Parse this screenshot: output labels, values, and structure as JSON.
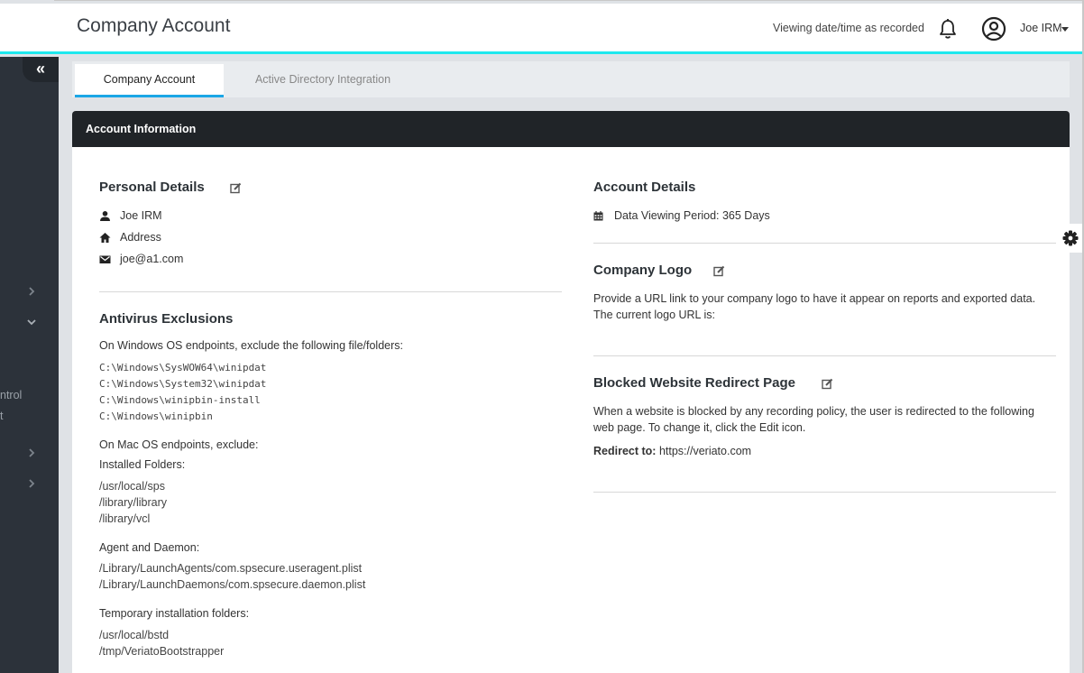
{
  "header": {
    "title": "Company Account",
    "viewing_text": "Viewing date/time as recorded",
    "user_name": "Joe IRM",
    "icons": {
      "notifications": "bell-icon",
      "user": "user-circle-icon",
      "dropdown": "caret-down-icon"
    }
  },
  "sidebar": {
    "collapse_icon": "«",
    "partial_labels": [
      "ntrol",
      "t"
    ],
    "chevrons": [
      "chevron-right",
      "chevron-down",
      "chevron-right",
      "chevron-right"
    ]
  },
  "tabs": [
    {
      "label": "Company Account",
      "active": true
    },
    {
      "label": "Active Directory Integration",
      "active": false
    }
  ],
  "card": {
    "title": "Account Information",
    "personal_details": {
      "heading": "Personal Details",
      "name": "Joe IRM",
      "address": "Address",
      "email": "joe@a1.com"
    },
    "antivirus": {
      "heading": "Antivirus Exclusions",
      "windows_intro": "On Windows OS endpoints, exclude the following file/folders:",
      "windows_paths": [
        "C:\\Windows\\SysWOW64\\winipdat",
        "C:\\Windows\\System32\\winipdat",
        "C:\\Windows\\winipbin-install",
        "C:\\Windows\\winipbin"
      ],
      "mac_intro": "On Mac OS endpoints, exclude:",
      "installed_label": "Installed Folders:",
      "installed_paths": [
        "/usr/local/sps",
        "/library/library",
        "/library/vcl"
      ],
      "agent_label": "Agent and Daemon:",
      "agent_paths": [
        "/Library/LaunchAgents/com.spsecure.useragent.plist",
        "/Library/LaunchDaemons/com.spsecure.daemon.plist"
      ],
      "temp_label": "Temporary installation folders:",
      "temp_paths": [
        "/usr/local/bstd",
        "/tmp/VeriatoBootstrapper"
      ]
    },
    "account_details": {
      "heading": "Account Details",
      "data_viewing_period": "Data Viewing Period: 365 Days"
    },
    "company_logo": {
      "heading": "Company Logo",
      "description_line1": "Provide a URL link to your company logo to have it appear on reports and exported data.",
      "description_line2": "The current logo URL is:"
    },
    "blocked_redirect": {
      "heading": "Blocked Website Redirect Page",
      "description_line1": "When a website is blocked by any recording policy, the user is redirected to the following",
      "description_line2": "web page. To change it, click the Edit icon.",
      "redirect_label": "Redirect to:",
      "redirect_url": "https://veriato.com"
    }
  },
  "colors": {
    "accent_cyan": "#1ee8ee",
    "tab_underline": "#1ba6e6",
    "card_header": "#202428",
    "sidebar": "#2c323a"
  }
}
